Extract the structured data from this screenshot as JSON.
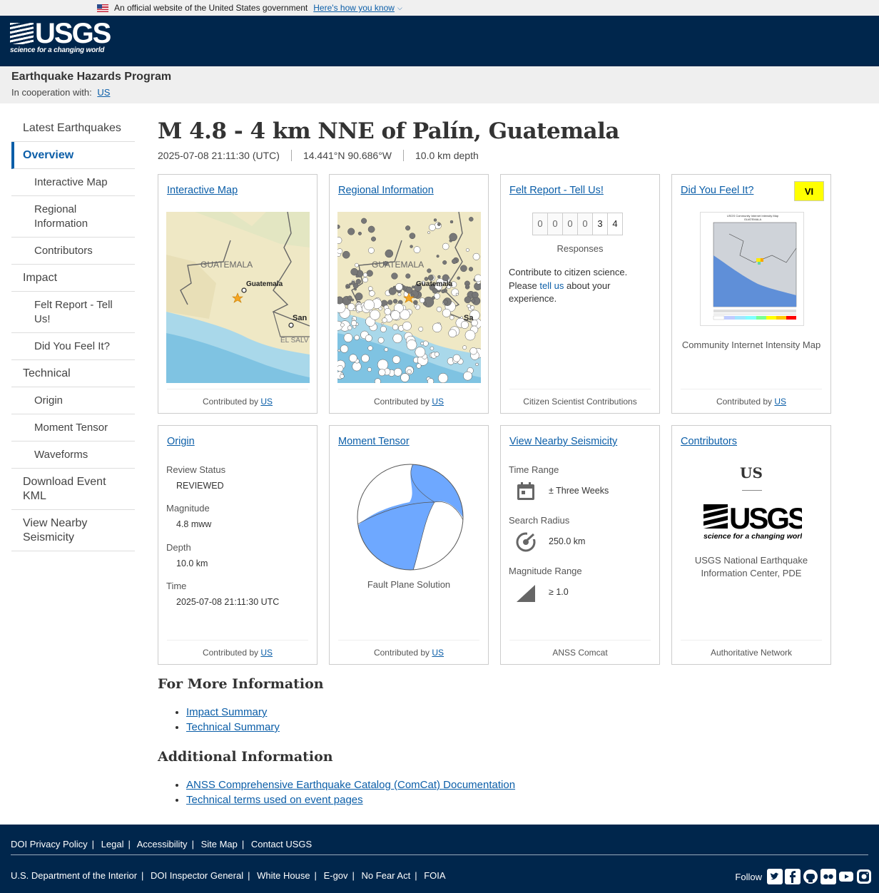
{
  "gov_banner": {
    "text": "An official website of the United States government",
    "link": "Here's how you know"
  },
  "header": {
    "logo_word": "USGS",
    "logo_tagline": "science for a changing world"
  },
  "program": {
    "title": "Earthquake Hazards Program",
    "coop_label": "In cooperation with:",
    "coop_link": "US"
  },
  "nav": {
    "items": [
      {
        "label": "Latest Earthquakes"
      },
      {
        "label": "Overview"
      },
      {
        "label": "Interactive Map"
      },
      {
        "label": "Regional Information"
      },
      {
        "label": "Contributors"
      },
      {
        "label": "Impact"
      },
      {
        "label": "Felt Report - Tell Us!"
      },
      {
        "label": "Did You Feel It?"
      },
      {
        "label": "Technical"
      },
      {
        "label": "Origin"
      },
      {
        "label": "Moment Tensor"
      },
      {
        "label": "Waveforms"
      },
      {
        "label": "Download Event KML"
      },
      {
        "label": "View Nearby Seismicity"
      }
    ]
  },
  "event": {
    "title": "M 4.8 - 4 km NNE of Palín, Guatemala",
    "time": "2025-07-08 21:11:30 (UTC)",
    "location": "14.441°N 90.686°W",
    "depth": "10.0 km depth"
  },
  "cards": {
    "interactive_map": {
      "title": "Interactive Map",
      "foot_prefix": "Contributed by",
      "foot_link": "US",
      "map_labels": {
        "country": "GUATEMALA",
        "city1": "Guatemala",
        "city2": "San",
        "country2": "EL SALV"
      }
    },
    "regional": {
      "title": "Regional Information",
      "foot_prefix": "Contributed by",
      "foot_link": "US",
      "map_labels": {
        "country": "GUATEMALA",
        "city1": "Guatemala",
        "city2": "Sa"
      }
    },
    "felt_report": {
      "title": "Felt Report - Tell Us!",
      "digits": [
        "0",
        "0",
        "0",
        "0",
        "3",
        "4"
      ],
      "responses": "Responses",
      "text_before": "Contribute to citizen science. Please",
      "link": "tell us",
      "text_after": "about your experience.",
      "foot": "Citizen Scientist Contributions"
    },
    "dyfi": {
      "title": "Did You Feel It?",
      "mmi": "VI",
      "mmi_color": "#ffff00",
      "caption": "Community Internet Intensity Map",
      "foot_prefix": "Contributed by",
      "foot_link": "US",
      "map_heading1": "USGS Community Internet Intensity Map",
      "map_heading2": "GUATEMALA"
    },
    "origin": {
      "title": "Origin",
      "review_label": "Review Status",
      "review_value": "REVIEWED",
      "mag_label": "Magnitude",
      "mag_value": "4.8 mww",
      "depth_label": "Depth",
      "depth_value": "10.0 km",
      "time_label": "Time",
      "time_value": "2025-07-08 21:11:30 UTC",
      "foot_prefix": "Contributed by",
      "foot_link": "US"
    },
    "moment_tensor": {
      "title": "Moment Tensor",
      "caption": "Fault Plane Solution",
      "beachball_color": "#6ea8ff",
      "foot_prefix": "Contributed by",
      "foot_link": "US"
    },
    "seismicity": {
      "title": "View Nearby Seismicity",
      "time_label": "Time Range",
      "time_value": "± Three Weeks",
      "radius_label": "Search Radius",
      "radius_value": "250.0 km",
      "mag_label": "Magnitude Range",
      "mag_value": "≥ 1.0",
      "foot": "ANSS Comcat"
    },
    "contributors": {
      "title": "Contributors",
      "code": "US",
      "logo_word": "USGS",
      "logo_tagline": "science for a changing world",
      "name": "USGS National Earthquake Information Center, PDE",
      "foot": "Authoritative Network"
    }
  },
  "more_info": {
    "heading": "For More Information",
    "links": [
      "Impact Summary",
      "Technical Summary"
    ]
  },
  "additional_info": {
    "heading": "Additional Information",
    "links": [
      "ANSS Comprehensive Earthquake Catalog (ComCat) Documentation",
      "Technical terms used on event pages"
    ]
  },
  "footer": {
    "row1": [
      "DOI Privacy Policy",
      "Legal",
      "Accessibility",
      "Site Map",
      "Contact USGS"
    ],
    "row2": [
      "U.S. Department of the Interior",
      "DOI Inspector General",
      "White House",
      "E-gov",
      "No Fear Act",
      "FOIA"
    ],
    "follow": "Follow",
    "social_icons": [
      "twitter-icon",
      "facebook-icon",
      "github-icon",
      "flickr-icon",
      "youtube-icon",
      "instagram-icon"
    ]
  }
}
